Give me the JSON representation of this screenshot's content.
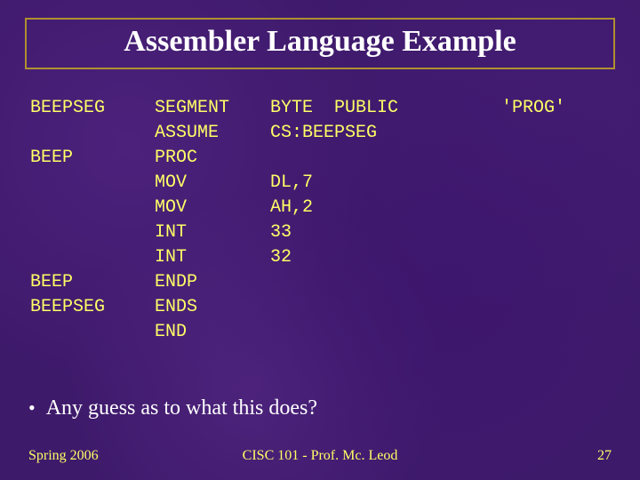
{
  "title": "Assembler Language Example",
  "code": {
    "rows": [
      {
        "c1": "BEEPSEG",
        "c2": "SEGMENT",
        "c3": "BYTE  PUBLIC",
        "c4": "'PROG'"
      },
      {
        "c1": "",
        "c2": "ASSUME",
        "c3": "CS:BEEPSEG",
        "c4": ""
      },
      {
        "c1": "BEEP",
        "c2": "PROC",
        "c3": "",
        "c4": ""
      },
      {
        "c1": "",
        "c2": "MOV",
        "c3": "DL,7",
        "c4": ""
      },
      {
        "c1": "",
        "c2": "MOV",
        "c3": "AH,2",
        "c4": ""
      },
      {
        "c1": "",
        "c2": "INT",
        "c3": "33",
        "c4": ""
      },
      {
        "c1": "",
        "c2": "INT",
        "c3": "32",
        "c4": ""
      },
      {
        "c1": "BEEP",
        "c2": "ENDP",
        "c3": "",
        "c4": ""
      },
      {
        "c1": "BEEPSEG",
        "c2": "ENDS",
        "c3": "",
        "c4": ""
      },
      {
        "c1": "",
        "c2": "END",
        "c3": "",
        "c4": ""
      }
    ]
  },
  "bullet": "Any guess as to what this does?",
  "footer": {
    "left": "Spring 2006",
    "center": "CISC 101 - Prof. Mc. Leod",
    "right": "27"
  }
}
